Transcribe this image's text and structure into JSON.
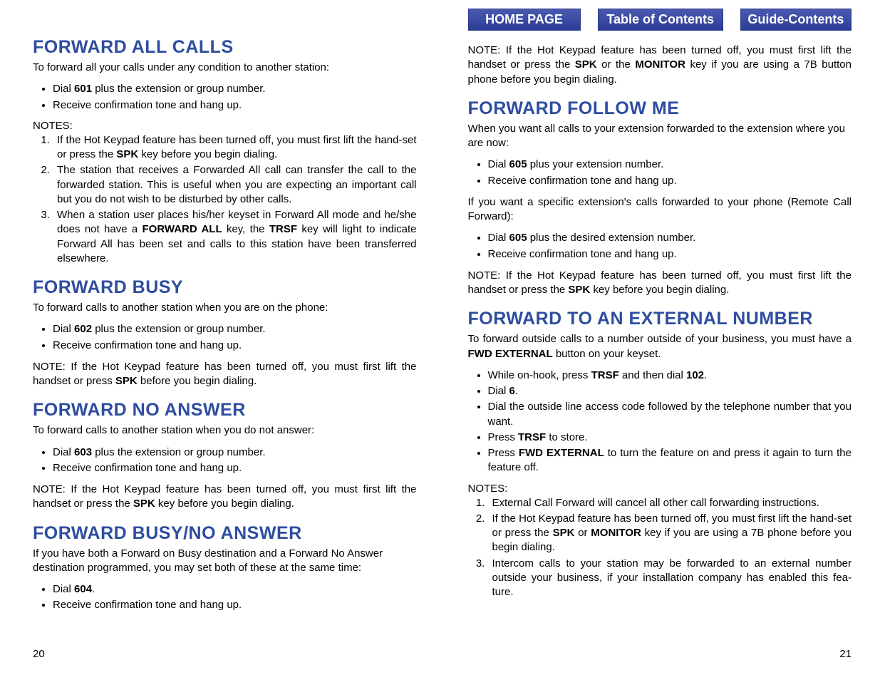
{
  "nav": {
    "home": "HOME PAGE",
    "toc": "Table of Contents",
    "guide": "Guide-Contents"
  },
  "left": {
    "s1": {
      "heading": "FORWARD ALL CALLS",
      "intro": "To forward all your calls under any condition to another station:",
      "b1a": "Dial ",
      "b1b": "601",
      "b1c": " plus the extension or group number.",
      "b2": "Receive confirmation tone and hang up.",
      "notes_label": "NOTES:",
      "n1a": "If the Hot Keypad feature has been turned off, you must first lift the hand-set or press the ",
      "n1b": "SPK",
      "n1c": " key before you begin dialing.",
      "n2": "The station that receives a Forwarded All call can transfer the call to the forwarded station. This is useful when you are expecting an important call but you do not wish to be disturbed by other calls.",
      "n3a": "When a station user places his/her keyset in Forward All mode and he/she does not have a ",
      "n3b": "FORWARD ALL",
      "n3c": " key, the ",
      "n3d": "TRSF",
      "n3e": " key will light to indicate Forward All has been set and calls to this station have been transferred elsewhere."
    },
    "s2": {
      "heading": "FORWARD BUSY",
      "intro": "To forward calls to another station when you are on the phone:",
      "b1a": "Dial ",
      "b1b": "602",
      "b1c": " plus the extension or group number.",
      "b2": "Receive confirmation tone and hang up.",
      "note_a": "NOTE:  If the Hot Keypad feature has been turned off, you must first lift the handset or press ",
      "note_b": "SPK",
      "note_c": " before you begin dialing."
    },
    "s3": {
      "heading": "FORWARD NO ANSWER",
      "intro": "To forward calls to another station when you do not answer:",
      "b1a": "Dial ",
      "b1b": "603",
      "b1c": " plus the extension or group number.",
      "b2": "Receive confirmation tone and hang up.",
      "note_a": "NOTE:  If the Hot Keypad feature has been turned off, you must first lift the handset or press the ",
      "note_b": "SPK",
      "note_c": " key before you begin dialing."
    },
    "s4": {
      "heading": "FORWARD BUSY/NO ANSWER",
      "intro": "If you have both a Forward on Busy destination and a Forward No Answer destination programmed, you may set both of these at the same time:",
      "b1a": "Dial ",
      "b1b": "604",
      "b1c": ".",
      "b2": "Receive confirmation tone and hang up."
    },
    "page_num": "20"
  },
  "right": {
    "top_note_a": "NOTE:  If the Hot Keypad feature has been turned off, you must first lift the handset or press the ",
    "top_note_b": "SPK",
    "top_note_c": " or the ",
    "top_note_d": "MONITOR",
    "top_note_e": " key if you are using a 7B button phone before you begin dialing.",
    "s1": {
      "heading": "FORWARD FOLLOW ME",
      "intro": "When you want all calls to your extension forwarded to the extension where you are now:",
      "b1a": "Dial ",
      "b1b": "605",
      "b1c": " plus your extension number.",
      "b2": "Receive confirmation tone and hang up.",
      "mid": "If you want a specific extension's calls forwarded to your phone (Remote Call Forward):",
      "b3a": "Dial ",
      "b3b": "605",
      "b3c": " plus the desired extension number.",
      "b4": "Receive confirmation tone and hang up.",
      "note_a": "NOTE:  If the Hot Keypad feature has been turned off, you must first lift the handset or press the ",
      "note_b": "SPK",
      "note_c": " key before you begin dialing."
    },
    "s2": {
      "heading": "FORWARD TO AN EXTERNAL NUMBER",
      "intro_a": "To forward outside calls to a number outside of your business, you must have a ",
      "intro_b": "FWD EXTERNAL",
      "intro_c": " button on your keyset.",
      "b1a": "While on-hook, press ",
      "b1b": "TRSF",
      "b1c": " and then dial ",
      "b1d": "102",
      "b1e": ".",
      "b2a": "Dial ",
      "b2b": "6",
      "b2c": ".",
      "b3": "Dial the outside line access code followed by the telephone number that you want.",
      "b4a": "Press ",
      "b4b": "TRSF",
      "b4c": " to store.",
      "b5a": "Press ",
      "b5b": "FWD EXTERNAL",
      "b5c": " to turn the feature on and press it again to turn the feature off.",
      "notes_label": "NOTES:",
      "n1": "External Call Forward will cancel all other call forwarding instructions.",
      "n2a": "If the Hot Keypad feature has been turned off, you must first lift the hand-set or press the ",
      "n2b": "SPK",
      "n2c": " or ",
      "n2d": "MONITOR",
      "n2e": " key if you are using a 7B phone before you begin dialing.",
      "n3": "Intercom calls to your station may be forwarded to an external number outside your business, if your installation company has enabled this fea-ture."
    },
    "page_num": "21"
  }
}
